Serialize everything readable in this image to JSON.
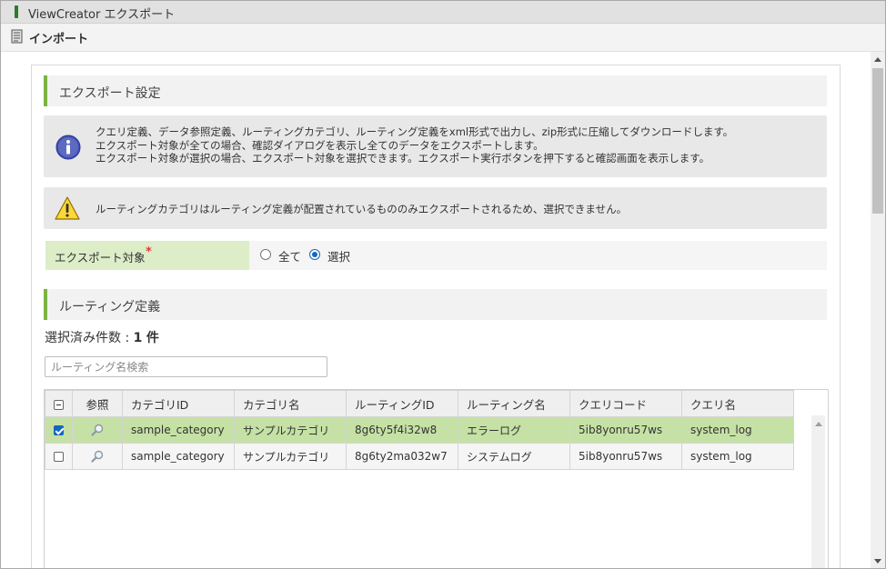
{
  "window": {
    "title": "ViewCreator エクスポート"
  },
  "toolbar": {
    "import_label": "インポート",
    "import_icon": "document-import-icon"
  },
  "export_settings": {
    "heading": "エクスポート設定",
    "info": {
      "icon": "info-icon",
      "lines": [
        "クエリ定義、データ参照定義、ルーティングカテゴリ、ルーティング定義をxml形式で出力し、zip形式に圧縮してダウンロードします。",
        "エクスポート対象が全ての場合、確認ダイアログを表示し全てのデータをエクスポートします。",
        "エクスポート対象が選択の場合、エクスポート対象を選択できます。エクスポート実行ボタンを押下すると確認画面を表示します。"
      ]
    },
    "warning": {
      "icon": "warning-icon",
      "text": "ルーティングカテゴリはルーティング定義が配置されているもののみエクスポートされるため、選択できません。"
    },
    "target": {
      "label": "エクスポート対象",
      "required_mark": "*",
      "options": [
        {
          "label": "全て",
          "selected": false
        },
        {
          "label": "選択",
          "selected": true
        }
      ]
    }
  },
  "routing": {
    "heading": "ルーティング定義",
    "count_label": "選択済み件数 : ",
    "count_value": "1",
    "count_unit": "件",
    "search_placeholder": "ルーティング名検索",
    "columns": [
      "参照",
      "カテゴリID",
      "カテゴリ名",
      "ルーティングID",
      "ルーティング名",
      "クエリコード",
      "クエリ名"
    ],
    "rows": [
      {
        "selected": true,
        "category_id": "sample_category",
        "category_name": "サンプルカテゴリ",
        "routing_id": "8g6ty5f4i32w8",
        "routing_name": "エラーログ",
        "query_code": "5ib8yonru57ws",
        "query_name": "system_log"
      },
      {
        "selected": false,
        "category_id": "sample_category",
        "category_name": "サンプルカテゴリ",
        "routing_id": "8g6ty2ma032w7",
        "routing_name": "システムログ",
        "query_code": "5ib8yonru57ws",
        "query_name": "system_log"
      }
    ]
  },
  "colors": {
    "accent_green": "#7cb342",
    "selected_row": "#c5e1a5",
    "label_bg": "#dcedc8",
    "checkbox_blue": "#1565c0"
  }
}
